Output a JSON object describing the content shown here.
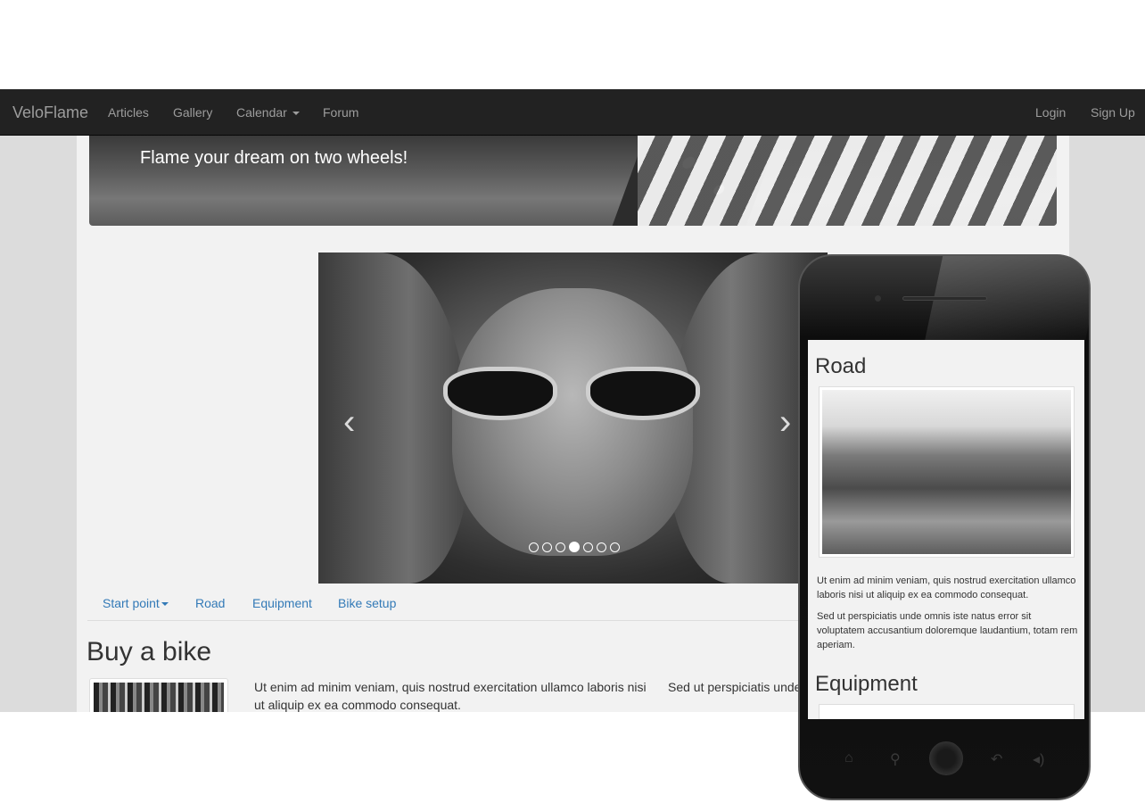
{
  "navbar": {
    "brand": "VeloFlame",
    "items": [
      {
        "label": "Articles"
      },
      {
        "label": "Gallery"
      },
      {
        "label": "Calendar",
        "dropdown": true
      },
      {
        "label": "Forum"
      }
    ],
    "right_items": [
      {
        "label": "Login"
      },
      {
        "label": "Sign Up"
      }
    ]
  },
  "banner": {
    "tagline": "Flame your dream on two wheels!"
  },
  "carousel": {
    "prev_icon": "chevron-left-icon",
    "next_icon": "chevron-right-icon",
    "slide_count": 7,
    "active_index": 3
  },
  "subnav": {
    "items": [
      {
        "label": "Start point",
        "dropdown": true
      },
      {
        "label": "Road"
      },
      {
        "label": "Equipment"
      },
      {
        "label": "Bike setup"
      }
    ]
  },
  "buy": {
    "heading": "Buy a bike",
    "para1": "Ut enim ad minim veniam, quis nostrud exercitation ullamco laboris nisi ut aliquip ex ea commodo consequat.",
    "para2": "Sed ut perspiciatis unde omnis iste natus error sit voluptatem accusantium doloremque"
  },
  "phone": {
    "road_title": "Road",
    "road_p1": "Ut enim ad minim veniam, quis nostrud exercitation ullamco laboris nisi ut aliquip ex ea commodo consequat.",
    "road_p2": "Sed ut perspiciatis unde omnis iste natus error sit voluptatem accusantium doloremque laudantium, totam rem aperiam.",
    "equipment_title": "Equipment",
    "buttons": [
      "home-icon",
      "search-icon",
      "home-button",
      "back-icon",
      "volume-icon"
    ]
  },
  "colors": {
    "navbar_bg": "#222222",
    "navbar_text": "#9d9d9d",
    "link_blue": "#337ab7",
    "page_bg": "#f2f2f2"
  }
}
